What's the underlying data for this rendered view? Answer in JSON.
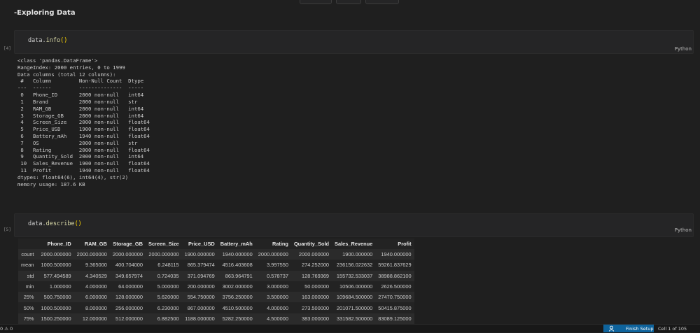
{
  "section": {
    "heading": "-Exploring Data"
  },
  "cells": [
    {
      "exec_count": "[4]",
      "code_obj": "data",
      "code_fn": "info",
      "code_paren": "()",
      "language": "Python"
    },
    {
      "exec_count": "[5]",
      "code_obj": "data",
      "code_fn": "describe",
      "code_paren": "()",
      "language": "Python"
    }
  ],
  "info_output": "<class 'pandas.DataFrame'>\nRangeIndex: 2000 entries, 0 to 1999\nData columns (total 12 columns):\n #   Column         Non-Null Count  Dtype  \n---  ------         --------------  -----  \n 0   Phone_ID       2000 non-null   int64  \n 1   Brand          2000 non-null   str    \n 2   RAM_GB         2000 non-null   int64  \n 3   Storage_GB     2000 non-null   int64  \n 4   Screen_Size    2000 non-null   float64\n 5   Price_USD      1900 non-null   float64\n 6   Battery_mAh    1940 non-null   float64\n 7   OS             2000 non-null   str    \n 8   Rating         2000 non-null   float64\n 9   Quantity_Sold  2000 non-null   int64  \n 10  Sales_Revenue  1900 non-null   float64\n 11  Profit         1940 non-null   float64\ndtypes: float64(6), int64(4), str(2)\nmemory usage: 187.6 KB",
  "describe_table": {
    "columns": [
      "",
      "Phone_ID",
      "RAM_GB",
      "Storage_GB",
      "Screen_Size",
      "Price_USD",
      "Battery_mAh",
      "Rating",
      "Quantity_Sold",
      "Sales_Revenue",
      "Profit"
    ],
    "rows": [
      [
        "count",
        "2000.000000",
        "2000.000000",
        "2000.000000",
        "2000.000000",
        "1900.000000",
        "1940.000000",
        "2000.000000",
        "2000.000000",
        "1900.000000",
        "1940.000000"
      ],
      [
        "mean",
        "1000.500000",
        "9.365000",
        "400.704000",
        "6.248115",
        "865.379474",
        "4516.403608",
        "3.997550",
        "274.252000",
        "236156.022632",
        "59261.837629"
      ],
      [
        "std",
        "577.494589",
        "4.340529",
        "349.657974",
        "0.724035",
        "371.094769",
        "863.964791",
        "0.578737",
        "128.769369",
        "155732.533037",
        "38988.862100"
      ],
      [
        "min",
        "1.000000",
        "4.000000",
        "64.000000",
        "5.000000",
        "200.000000",
        "3002.000000",
        "3.000000",
        "50.000000",
        "10506.000000",
        "2626.500000"
      ],
      [
        "25%",
        "500.750000",
        "6.000000",
        "128.000000",
        "5.620000",
        "554.750000",
        "3756.250000",
        "3.500000",
        "163.000000",
        "109684.500000",
        "27470.750000"
      ],
      [
        "50%",
        "1000.500000",
        "8.000000",
        "256.000000",
        "6.230000",
        "867.000000",
        "4510.500000",
        "4.000000",
        "273.500000",
        "201071.500000",
        "50415.875000"
      ],
      [
        "75%",
        "1500.250000",
        "12.000000",
        "512.000000",
        "6.882500",
        "1188.000000",
        "5282.250000",
        "4.500000",
        "383.000000",
        "331582.500000",
        "83089.125000"
      ]
    ]
  },
  "statusbar": {
    "left": "0 ⚠ 0",
    "finish_setup": "Finish Setup",
    "cell_position": "Cell 1 of 105",
    "finish_icon": "account-icon"
  }
}
